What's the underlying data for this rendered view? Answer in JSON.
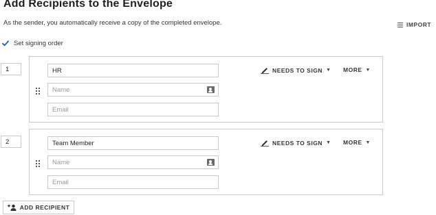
{
  "page": {
    "title": "Add Recipients to the Envelope",
    "subtitle": "As the sender, you automatically receive a copy of the completed envelope."
  },
  "import": {
    "label": "IMPORT",
    "icon": "list-icon"
  },
  "signing_order": {
    "label": "Set signing order",
    "checked": true
  },
  "recipients": [
    {
      "order": "1",
      "role": "HR",
      "name_placeholder": "Name",
      "email_placeholder": "Email",
      "action_label": "NEEDS TO SIGN",
      "more_label": "MORE"
    },
    {
      "order": "2",
      "role": "Team Member",
      "name_placeholder": "Name",
      "email_placeholder": "Email",
      "action_label": "NEEDS TO SIGN",
      "more_label": "MORE"
    }
  ],
  "add_recipient": {
    "label": "ADD RECIPIENT",
    "icon": "add-person-icon"
  },
  "colors": {
    "accent": "#1a5fb4",
    "border": "#c8c8c8",
    "text": "#262626"
  }
}
